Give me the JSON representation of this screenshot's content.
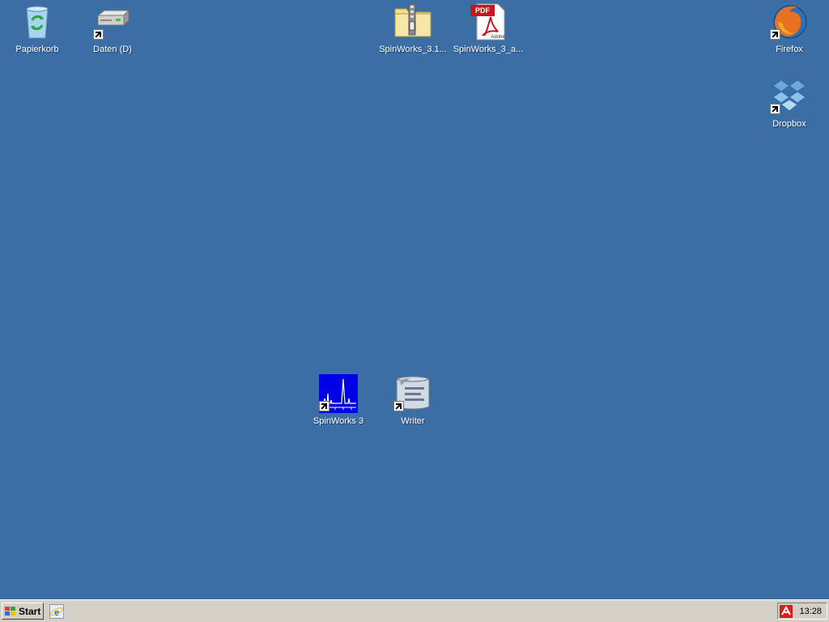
{
  "desktop": {
    "icons": [
      {
        "label": "Papierkorb",
        "icon": "recycle-bin-icon"
      },
      {
        "label": "Daten (D)",
        "icon": "hard-drive-icon"
      },
      {
        "label": "SpinWorks_3.1...",
        "icon": "zip-folder-icon"
      },
      {
        "label": "SpinWorks_3_a...",
        "icon": "pdf-icon"
      },
      {
        "label": "Firefox",
        "icon": "firefox-icon"
      },
      {
        "label": "Dropbox",
        "icon": "dropbox-icon"
      },
      {
        "label": "SpinWorks 3",
        "icon": "spinworks-icon"
      },
      {
        "label": "Writer",
        "icon": "writer-icon"
      }
    ],
    "background_color": "#3a6ea5"
  },
  "taskbar": {
    "start_label": "Start",
    "quicklaunch_icon": "internet-explorer-icon",
    "tray_icon": "antivirus-icon",
    "clock": "13:28"
  },
  "pdf_badge": "PDF",
  "pdf_brand": "Adobe"
}
